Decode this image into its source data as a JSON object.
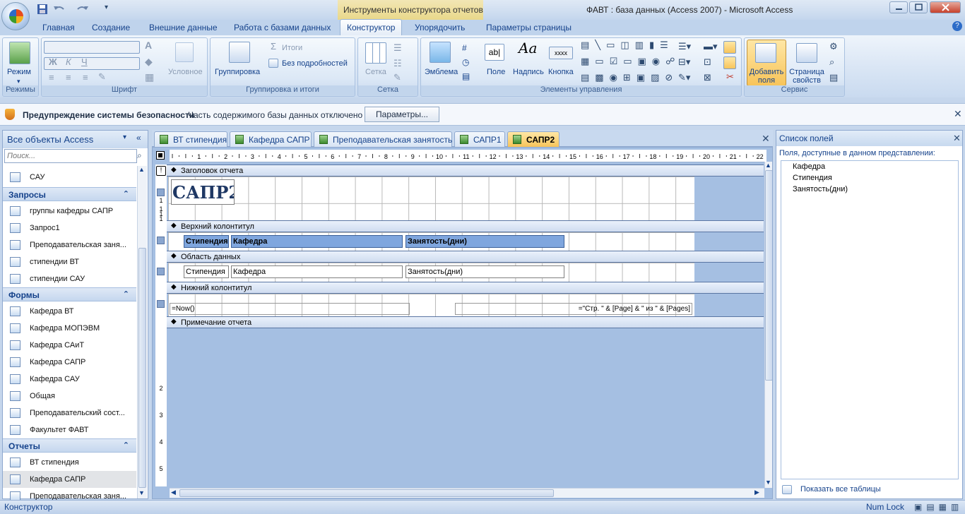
{
  "title_bar": {
    "contextual_tab": "Инструменты конструктора отчетов",
    "window_title": "ФАВТ : база данных (Access 2007) - Microsoft Access"
  },
  "ribbon_tabs": [
    "Главная",
    "Создание",
    "Внешние данные",
    "Работа с базами данных",
    "Конструктор",
    "Упорядочить",
    "Параметры страницы"
  ],
  "active_tab": "Конструктор",
  "ribbon": {
    "views": {
      "button": "Режим",
      "caption": "Режимы"
    },
    "font": {
      "conditional": "Условное",
      "caption": "Шрифт"
    },
    "grouping": {
      "group_button": "Группировка",
      "totals": "Итоги",
      "hide_details": "Без подробностей",
      "caption": "Группировка и итоги"
    },
    "grid": {
      "button": "Сетка",
      "caption": "Сетка"
    },
    "controls": {
      "logo": "Эмблема",
      "field": "Поле",
      "label": "Надпись",
      "button": "Кнопка",
      "button_glyph": "xxxx",
      "caption": "Элементы управления"
    },
    "tools": {
      "add_fields": "Добавить поля",
      "property_sheet": "Страница свойств",
      "caption": "Сервис"
    }
  },
  "security_bar": {
    "title": "Предупреждение системы безопасности",
    "message": "Часть содержимого базы данных отключено",
    "button": "Параметры..."
  },
  "nav": {
    "header": "Все объекты Access",
    "search_placeholder": "Поиск...",
    "top_items": [
      "САУ"
    ],
    "groups": [
      {
        "title": "Запросы",
        "items": [
          "группы кафедры САПР",
          "Запрос1",
          "Преподавательская заня...",
          "стипендии ВТ",
          "стипендии САУ"
        ]
      },
      {
        "title": "Формы",
        "items": [
          "Кафедра ВТ",
          "Кафедра МОПЭВМ",
          "Кафедра САиТ",
          "Кафедра САПР",
          "Кафедра САУ",
          "Общая",
          "Преподавательский сост...",
          "Факультет ФАВТ"
        ]
      },
      {
        "title": "Отчеты",
        "items": [
          "ВТ стипендия",
          "Кафедра САПР",
          "Преподавательская заня..."
        ]
      }
    ],
    "selected_item": "Кафедра САПР"
  },
  "doc_tabs": [
    "ВТ стипендия",
    "Кафедра САПР",
    "Преподавательская занятость",
    "САПР1",
    "САПР2"
  ],
  "active_doc_tab": "САПР2",
  "ruler_numbers": [
    "1",
    "2",
    "3",
    "4",
    "5",
    "6",
    "7",
    "8",
    "9",
    "10",
    "11",
    "12",
    "13",
    "14",
    "15",
    "16",
    "17",
    "18",
    "19",
    "20",
    "21",
    "22"
  ],
  "vruler_numbers": [
    "1",
    "1",
    "1",
    "1",
    "2",
    "3",
    "4",
    "5"
  ],
  "report": {
    "sections": [
      "Заголовок отчета",
      "Верхний колонтитул",
      "Область данных",
      "Нижний колонтитул",
      "Примечание отчета"
    ],
    "title": "САПР2",
    "header_labels": [
      "Стипендия",
      "Кафедра",
      "Занятость(дни)"
    ],
    "detail_fields": [
      "Стипендия",
      "Кафедра",
      "Занятость(дни)"
    ],
    "footer_now": "=Now()",
    "footer_page": "=\"Стр. \" & [Page] & \" из \" & [Pages]"
  },
  "field_list": {
    "title": "Список полей",
    "subtitle": "Поля, доступные в данном представлении:",
    "fields": [
      "Кафедра",
      "Стипендия",
      "Занятость(дни)"
    ],
    "show_all": "Показать все таблицы"
  },
  "status": {
    "mode": "Конструктор",
    "numlock": "Num Lock"
  }
}
